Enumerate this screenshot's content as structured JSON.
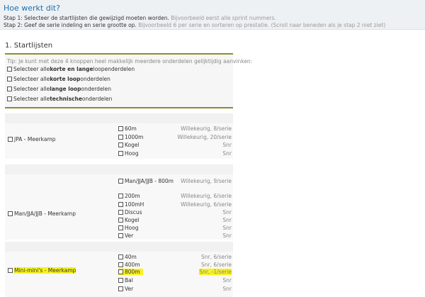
{
  "howto": {
    "title": "Hoe werkt dit?",
    "step1": "Stap 1: Selecteer de startlijsten die gewijzigd moeten worden.",
    "step1_hint": "Bijvoorbeeld eerst alle sprint nummers.",
    "step2": "Stap 2: Geef de serie indeling en serie grootte op.",
    "step2_hint": "Bijvoorbeeld 6 per serie en sorteren op prestatie. (Scroll naar beneden als je stap 2 niet ziet)"
  },
  "section": {
    "title": "1. Startlijsten",
    "tip": "Tip: Je kunt met deze 4 knoppen heel makkelijk meerdere onderdelen gelijktijdig aanvinken:",
    "selectors": [
      {
        "pre": "Selecteer alle ",
        "bold": "korte en lange",
        "post": " loopenderdelen"
      },
      {
        "pre": "Selecteer alle ",
        "bold": "korte loop",
        "post": "onderdelen"
      },
      {
        "pre": "Selecteer alle ",
        "bold": "lange loop",
        "post": "onderdelen"
      },
      {
        "pre": "Selecteer alle ",
        "bold": "technische",
        "post": " onderdelen"
      }
    ]
  },
  "groups": [
    {
      "name": "JPA - Meerkamp",
      "events": [
        {
          "name": "60m",
          "config": "Willekeurig, 8/serie"
        },
        {
          "name": "1000m",
          "config": "Willekeurig, 20/serie"
        },
        {
          "name": "Kogel",
          "config": "Snr"
        },
        {
          "name": "Hoog",
          "config": "Snr"
        }
      ]
    },
    {
      "name": "Man/JJA/JJB - Meerkamp",
      "header_event": {
        "name": "Man/JJA/JJB - 800m",
        "config": "Willekeurig, 9/serie"
      },
      "events": [
        {
          "name": "200m",
          "config": "Willekeurig, 6/serie"
        },
        {
          "name": "100mH",
          "config": "Willekeurig, 6/serie"
        },
        {
          "name": "Discus",
          "config": "Snr"
        },
        {
          "name": "Kogel",
          "config": "Snr"
        },
        {
          "name": "Hoog",
          "config": "Snr"
        },
        {
          "name": "Ver",
          "config": "Snr"
        }
      ]
    },
    {
      "name": "Mini-mini's - Meerkamp",
      "events": [
        {
          "name": "40m",
          "config": "Snr, 6/serie"
        },
        {
          "name": "400m",
          "config": "Snr, 6/serie"
        },
        {
          "name": "800m",
          "config": "Snr, -1/serie"
        },
        {
          "name": "Bal",
          "config": "Snr"
        },
        {
          "name": "Ver",
          "config": "Snr"
        }
      ]
    }
  ],
  "highlight_color": "#f7f21f"
}
